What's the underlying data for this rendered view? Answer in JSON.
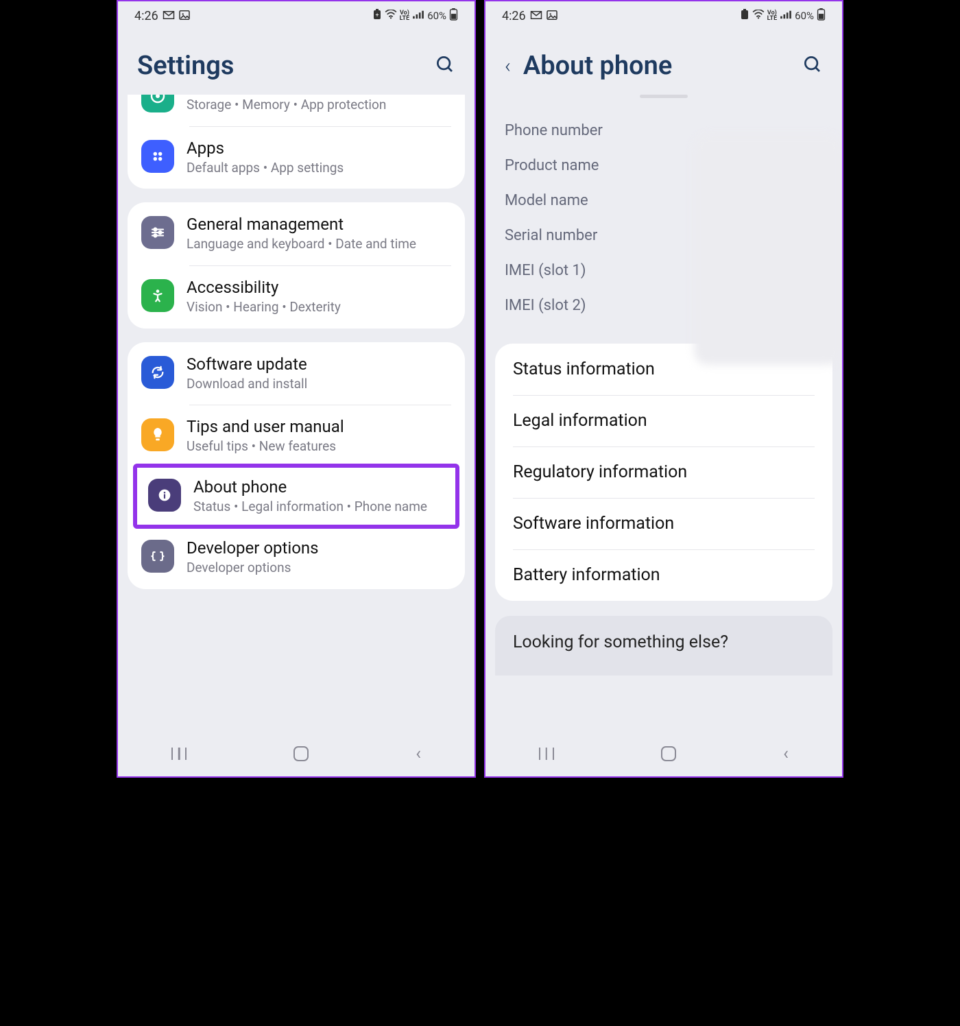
{
  "statusbar": {
    "time": "4:26",
    "battery": "60%",
    "volte": "Vo)\nLTE"
  },
  "left": {
    "title": "Settings",
    "items": [
      {
        "key": "devicecare",
        "title": "",
        "sub": "Storage  •  Memory  •  App protection"
      },
      {
        "key": "apps",
        "title": "Apps",
        "sub": "Default apps  •  App settings"
      },
      {
        "key": "general",
        "title": "General management",
        "sub": "Language and keyboard  •  Date and time"
      },
      {
        "key": "access",
        "title": "Accessibility",
        "sub": "Vision  •  Hearing  •  Dexterity"
      },
      {
        "key": "swupdate",
        "title": "Software update",
        "sub": "Download and install"
      },
      {
        "key": "tips",
        "title": "Tips and user manual",
        "sub": "Useful tips  •  New features"
      },
      {
        "key": "about",
        "title": "About phone",
        "sub": "Status  •  Legal information  •  Phone name"
      },
      {
        "key": "developer",
        "title": "Developer options",
        "sub": "Developer options"
      }
    ]
  },
  "right": {
    "title": "About phone",
    "info": {
      "phone_number": "Phone number",
      "product_name": "Product name",
      "model_name": "Model name",
      "serial_number": "Serial number",
      "imei1": "IMEI (slot 1)",
      "imei2": "IMEI (slot 2)"
    },
    "options": [
      "Status information",
      "Legal information",
      "Regulatory information",
      "Software information",
      "Battery information"
    ],
    "looking": "Looking for something else?"
  }
}
